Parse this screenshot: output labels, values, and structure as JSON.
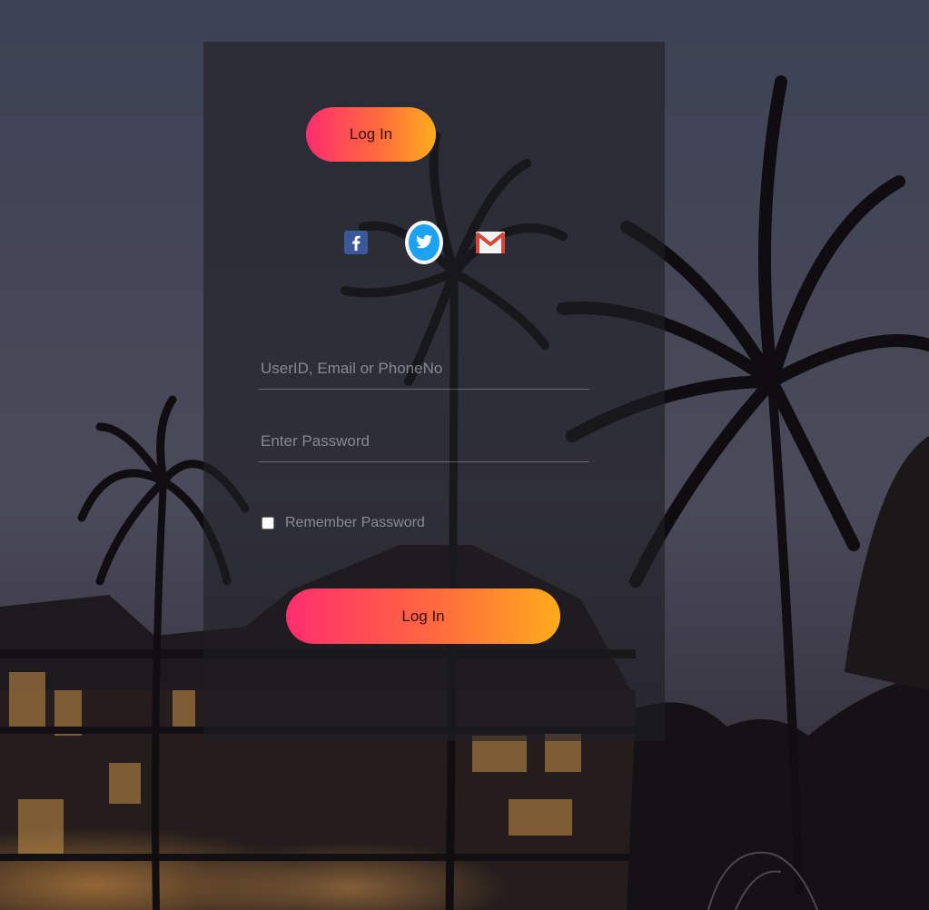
{
  "login_tab": {
    "label": "Log In"
  },
  "social": {
    "facebook_icon": "facebook-icon",
    "twitter_icon": "twitter-icon",
    "gmail_icon": "gmail-icon"
  },
  "form": {
    "user_placeholder": "UserID, Email or PhoneNo",
    "password_placeholder": "Enter Password",
    "remember_label": "Remember Password",
    "submit_label": "Log In"
  },
  "colors": {
    "gradient_start": "#ff2d6f",
    "gradient_end": "#ffac1c",
    "panel": "#1e1e24"
  }
}
